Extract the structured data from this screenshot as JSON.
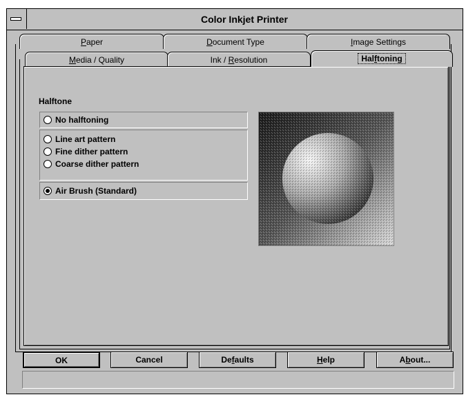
{
  "window": {
    "title": "Color Inkjet Printer"
  },
  "tabs_back": [
    {
      "label_pre": "",
      "label_u": "P",
      "label_post": "aper"
    },
    {
      "label_pre": "",
      "label_u": "D",
      "label_post": "ocument Type"
    },
    {
      "label_pre": "",
      "label_u": "I",
      "label_post": "mage Settings"
    }
  ],
  "tabs_front": [
    {
      "label_pre": "",
      "label_u": "M",
      "label_post": "edia / Quality"
    },
    {
      "label_pre": "Ink / ",
      "label_u": "R",
      "label_post": "esolution"
    },
    {
      "label_pre": "Hal",
      "label_u": "f",
      "label_post": "toning"
    }
  ],
  "halftone": {
    "label": "Halftone",
    "options": [
      {
        "label": "No halftoning",
        "selected": false
      },
      {
        "label": "Line art pattern",
        "selected": false
      },
      {
        "label": "Fine dither pattern",
        "selected": false
      },
      {
        "label": "Coarse dither pattern",
        "selected": false
      },
      {
        "label": "Air Brush (Standard)",
        "selected": true
      }
    ]
  },
  "buttons": {
    "ok": "OK",
    "cancel": "Cancel",
    "defaults_pre": "De",
    "defaults_u": "f",
    "defaults_post": "aults",
    "help_u": "H",
    "help_post": "elp",
    "about_pre": "A",
    "about_u": "b",
    "about_post": "out..."
  },
  "colors": {
    "face": "#c0c0c0",
    "shadow": "#808080",
    "highlight": "#ffffff"
  }
}
